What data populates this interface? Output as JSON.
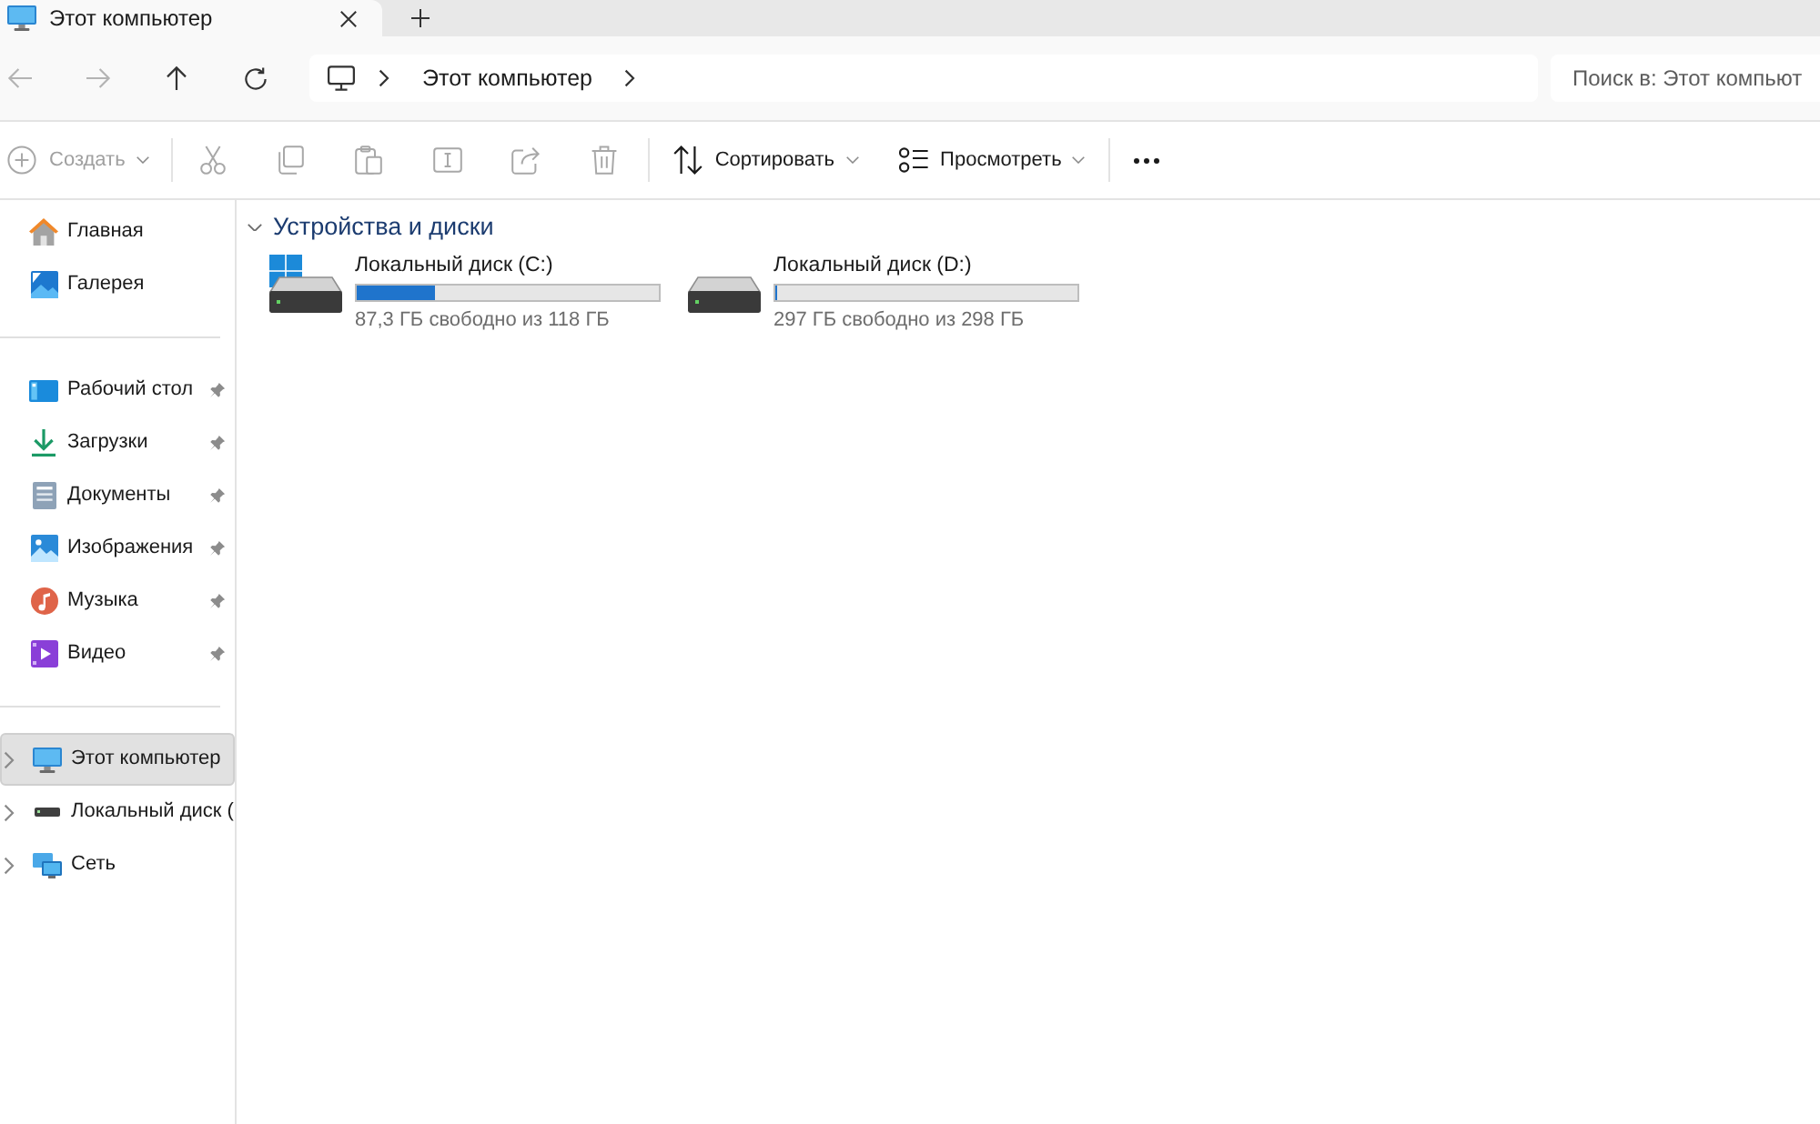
{
  "tabs": [
    {
      "title": "Этот компьютер",
      "selected": true
    }
  ],
  "navigation": [
    {
      "kind": "back",
      "disabled": true
    },
    {
      "kind": "forward",
      "disabled": true
    },
    {
      "kind": "up",
      "disabled": false
    },
    {
      "kind": "refresh",
      "disabled": false
    }
  ],
  "address_bar": {
    "segments": [
      "Этот компьютер"
    ]
  },
  "search": {
    "placeholder": "Поиск в: Этот компьют"
  },
  "command_bar": {
    "groups": [
      [
        {
          "kind": "new",
          "label": "Создать",
          "dropdown": true,
          "disabled": true
        }
      ],
      [
        {
          "kind": "cut",
          "dropdown": false,
          "disabled": true
        },
        {
          "kind": "copy",
          "dropdown": false,
          "disabled": true
        },
        {
          "kind": "paste",
          "dropdown": false,
          "disabled": true
        },
        {
          "kind": "rename",
          "dropdown": false,
          "disabled": true
        },
        {
          "kind": "share",
          "dropdown": false,
          "disabled": true
        },
        {
          "kind": "delete",
          "dropdown": false,
          "disabled": true
        }
      ],
      [
        {
          "kind": "sort",
          "label": "Сортировать",
          "dropdown": true,
          "disabled": false
        },
        {
          "kind": "view",
          "label": "Просмотреть",
          "dropdown": true,
          "disabled": false
        }
      ],
      [
        {
          "kind": "more",
          "dropdown": false,
          "disabled": false
        }
      ]
    ]
  },
  "sidebar": {
    "sections": [
      {
        "items": [
          {
            "kind": "home",
            "label": "Главная",
            "selected": false
          },
          {
            "kind": "gallery",
            "label": "Галерея",
            "selected": false
          }
        ]
      },
      {
        "items": [
          {
            "kind": "desktop",
            "label": "Рабочий стол",
            "selected": false,
            "pinned": true
          },
          {
            "kind": "downloads",
            "label": "Загрузки",
            "selected": false,
            "pinned": true
          },
          {
            "kind": "documents",
            "label": "Документы",
            "selected": false,
            "pinned": true
          },
          {
            "kind": "pictures",
            "label": "Изображения",
            "selected": false,
            "pinned": true
          },
          {
            "kind": "music",
            "label": "Музыка",
            "selected": false,
            "pinned": true
          },
          {
            "kind": "video",
            "label": "Видео",
            "selected": false,
            "pinned": true
          }
        ]
      },
      {
        "items": [
          {
            "kind": "computer",
            "label": "Этот компьютер",
            "selected": true,
            "expanded": false
          },
          {
            "kind": "drive",
            "label": "Локальный диск (",
            "selected": false,
            "expanded": false
          },
          {
            "kind": "network",
            "label": "Сеть",
            "selected": false,
            "expanded": false
          }
        ]
      }
    ]
  },
  "content": {
    "groups": [
      {
        "title": "Устройства и диски",
        "expanded": true,
        "drives": [
          {
            "kind": "system",
            "name": "Локальный диск (C:)",
            "level": 0.26,
            "free": "87,3 ГБ свободно из 118 ГБ"
          },
          {
            "kind": "data",
            "name": "Локальный диск (D:)",
            "level": 0.003,
            "free": "297 ГБ свободно из 298 ГБ"
          }
        ]
      }
    ]
  }
}
